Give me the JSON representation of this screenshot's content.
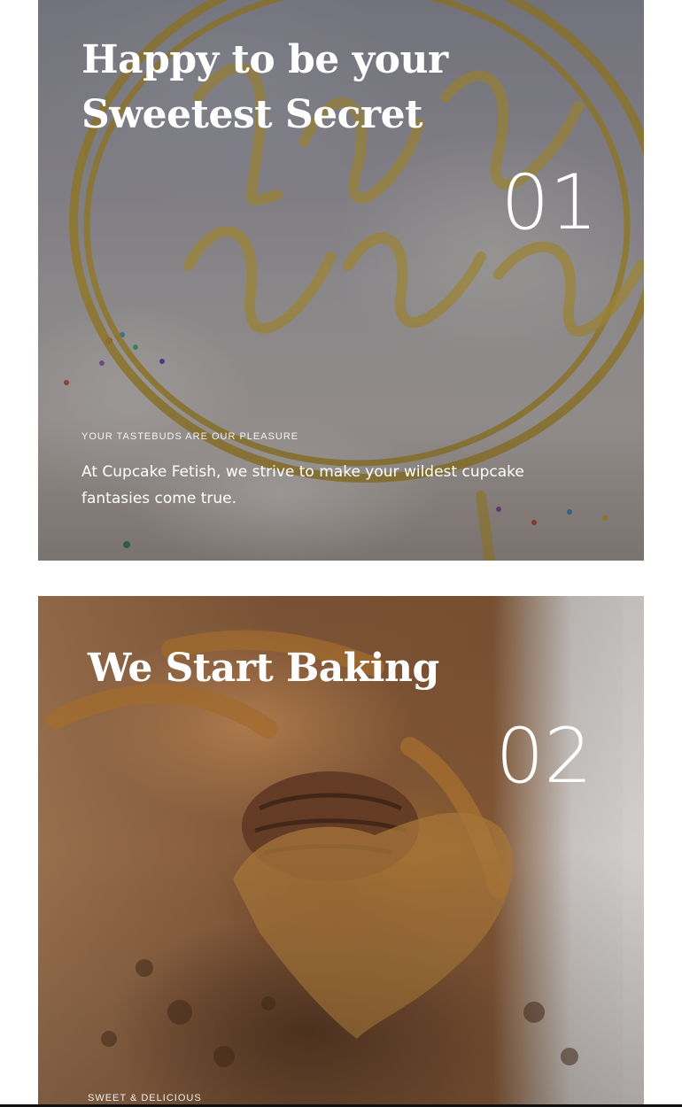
{
  "features": [
    {
      "title_line_1": "Happy to be your",
      "title_line_2": "Sweetest Secret",
      "number": "01",
      "eyebrow": "YOUR TASTEBUDS ARE OUR PLEASURE",
      "description": "At Cupcake Fetish, we strive to make your wildest cupcake fantasies come true."
    },
    {
      "title": "We Start Baking",
      "number": "02",
      "eyebrow": "SWEET & DELICIOUS"
    }
  ],
  "colors": {
    "text": "#ffffff",
    "page_background": "#ffffff",
    "topper_gold": "#b9972a"
  }
}
